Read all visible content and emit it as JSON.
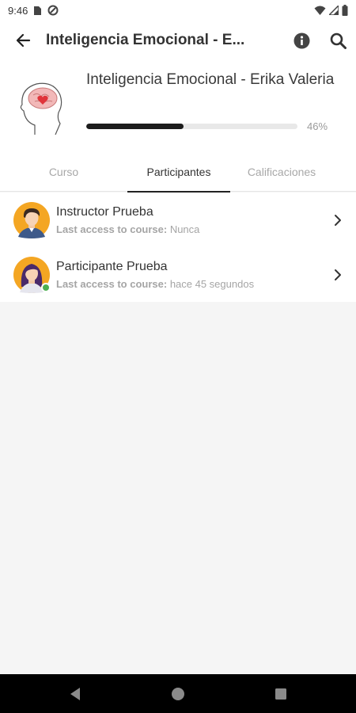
{
  "status_bar": {
    "time": "9:46",
    "icons": [
      "sim-card-icon",
      "data-saver-icon",
      "wifi-icon",
      "signal-icon",
      "battery-icon"
    ]
  },
  "app_bar": {
    "title": "Inteligencia Emocional - E...",
    "icons": [
      "back-arrow-icon",
      "info-icon",
      "search-icon"
    ]
  },
  "course": {
    "name": "Inteligencia Emocional - Erika Valeria",
    "image": "brain-heart-illustration",
    "progress": 46,
    "progress_label": "46%"
  },
  "tabs": [
    {
      "label": "Curso",
      "active": false
    },
    {
      "label": "Participantes",
      "active": true
    },
    {
      "label": "Calificaciones",
      "active": false
    }
  ],
  "participants": [
    {
      "name": "Instructor Prueba",
      "last_access_label": "Last access to course:",
      "last_access_value": "Nunca",
      "online": false,
      "avatar": "male-avatar"
    },
    {
      "name": "Participante Prueba",
      "last_access_label": "Last access to course:",
      "last_access_value": "hace 45 segundos",
      "online": true,
      "avatar": "female-avatar"
    }
  ],
  "nav_bar": {
    "icons": [
      "nav-back-icon",
      "nav-home-icon",
      "nav-recents-icon"
    ]
  },
  "colors": {
    "progress_fill": "#1c1c1c",
    "progress_track": "#e8e8e8",
    "online_dot": "#4caf50",
    "avatar_bg": "#f4a623",
    "page_bg": "#f5f5f5"
  }
}
